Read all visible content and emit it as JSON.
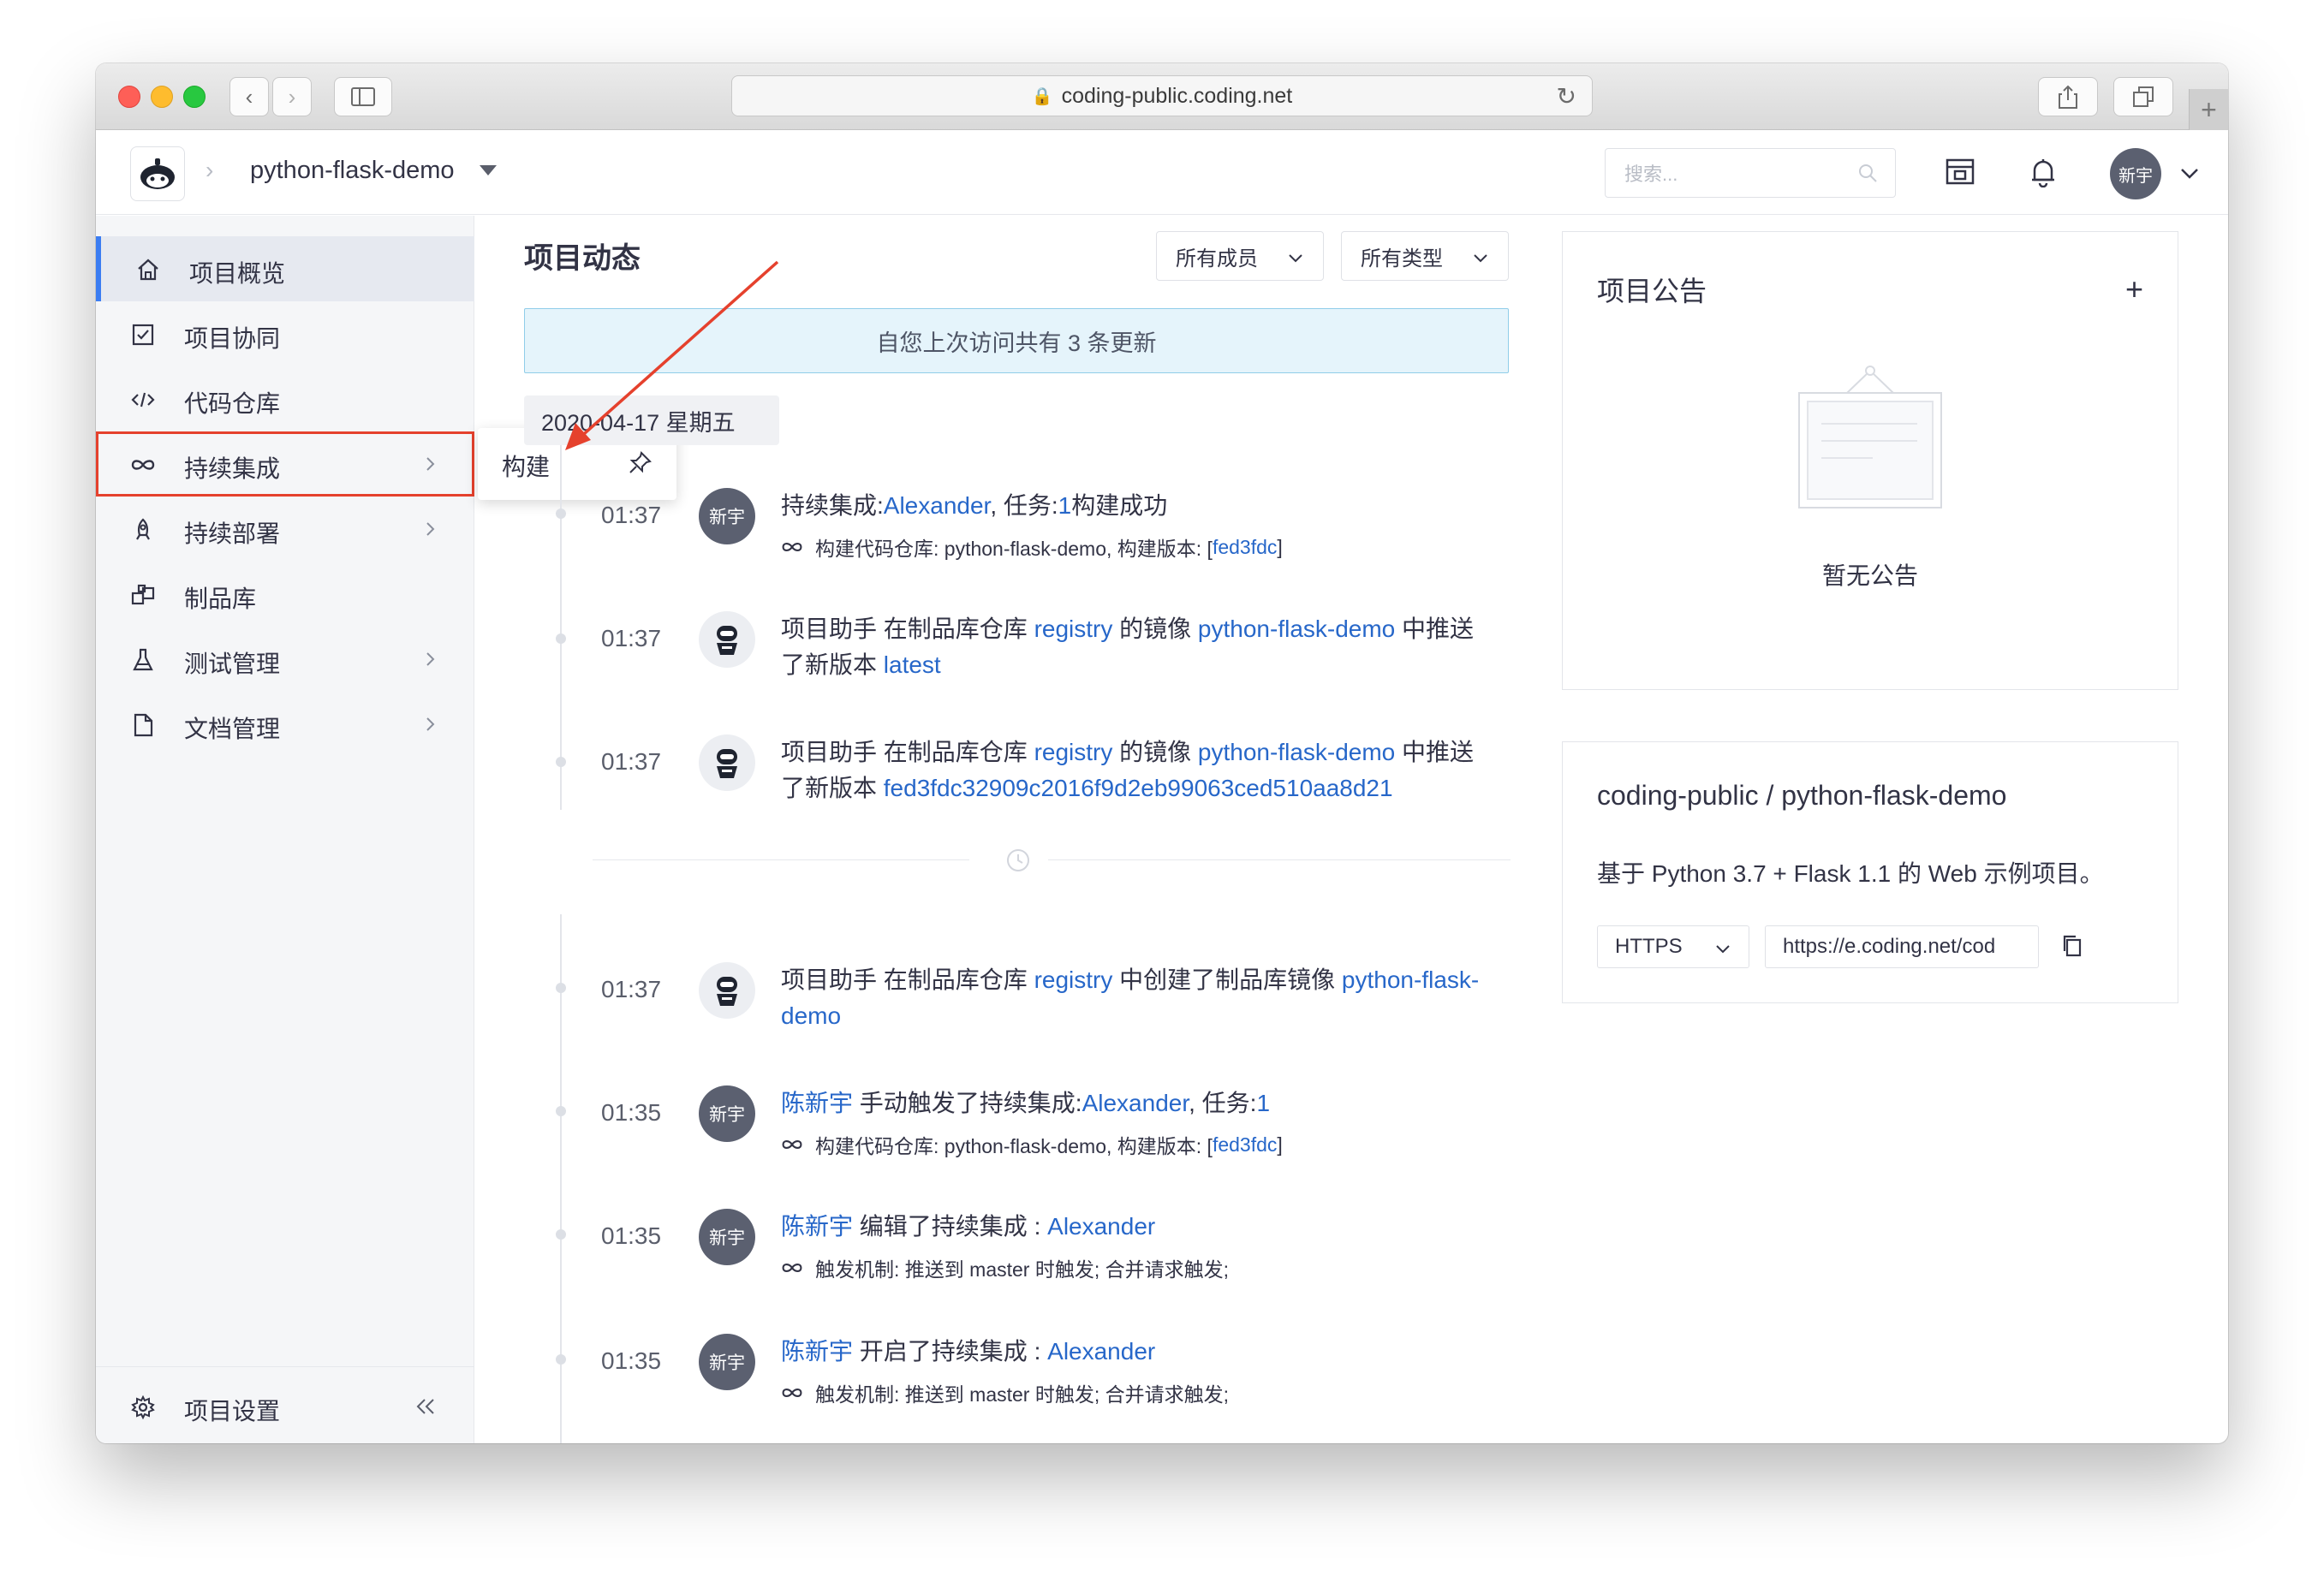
{
  "browser": {
    "url": "coding-public.coding.net"
  },
  "topbar": {
    "project_name": "python-flask-demo",
    "search_placeholder": "搜索...",
    "user_avatar": "新宇"
  },
  "sidebar": {
    "items": [
      {
        "label": "项目概览",
        "icon": "home-icon"
      },
      {
        "label": "项目协同",
        "icon": "checkbox-icon"
      },
      {
        "label": "代码仓库",
        "icon": "code-icon"
      },
      {
        "label": "持续集成",
        "icon": "infinity-icon"
      },
      {
        "label": "持续部署",
        "icon": "rocket-icon"
      },
      {
        "label": "制品库",
        "icon": "artifact-icon"
      },
      {
        "label": "测试管理",
        "icon": "flask-icon"
      },
      {
        "label": "文档管理",
        "icon": "document-icon"
      }
    ],
    "settings_label": "项目设置"
  },
  "flyout": {
    "label": "构建"
  },
  "feed": {
    "title": "项目动态",
    "filter_members": "所有成员",
    "filter_types": "所有类型",
    "notice": "自您上次访问共有 3 条更新",
    "date": "2020-04-17 星期五",
    "events": [
      {
        "time": "01:37",
        "avatar": "新宇",
        "p1": "持续集成:",
        "l1": "Alexander",
        "p2": ", 任务:",
        "l2": "1",
        "p3": "构建成功",
        "sub_prefix": "构建代码仓库: python-flask-demo, 构建版本: [",
        "sub_link": "fed3fdc",
        "sub_suffix": "]"
      },
      {
        "time": "01:37",
        "p1": "项目助手 在制品库仓库 ",
        "l1": "registry",
        "p2": " 的镜像 ",
        "l2": "python-flask-demo",
        "p3": " 中推送了新版本 ",
        "l3": "latest"
      },
      {
        "time": "01:37",
        "p1": "项目助手 在制品库仓库 ",
        "l1": "registry",
        "p2": " 的镜像 ",
        "l2": "python-flask-demo",
        "p3": " 中推送了新版本 ",
        "l3": "fed3fdc32909c2016f9d2eb99063ced510aa8d21"
      },
      {
        "time": "01:37",
        "p1": "项目助手 在制品库仓库 ",
        "l1": "registry",
        "p2": " 中创建了制品库镜像 ",
        "l2": "python-flask-demo"
      },
      {
        "time": "01:35",
        "avatar": "新宇",
        "l0": "陈新宇",
        "p1": " 手动触发了持续集成:",
        "l1": "Alexander",
        "p2": ", 任务:",
        "l2": "1",
        "sub_prefix": "构建代码仓库: python-flask-demo, 构建版本: [",
        "sub_link": "fed3fdc",
        "sub_suffix": "]"
      },
      {
        "time": "01:35",
        "avatar": "新宇",
        "l0": "陈新宇",
        "p1": " 编辑了持续集成 : ",
        "l1": "Alexander",
        "sub_prefix": "触发机制: 推送到 master 时触发; 合并请求触发;"
      },
      {
        "time": "01:35",
        "avatar": "新宇",
        "l0": "陈新宇",
        "p1": " 开启了持续集成 : ",
        "l1": "Alexander",
        "sub_prefix": "触发机制: 推送到 master 时触发; 合并请求触发;"
      }
    ]
  },
  "announcement": {
    "title": "项目公告",
    "empty_text": "暂无公告"
  },
  "repo": {
    "title": "coding-public / python-flask-demo",
    "description": "基于 Python 3.7 + Flask 1.1 的 Web 示例项目。",
    "protocol": "HTTPS",
    "clone_url": "https://e.coding.net/cod"
  },
  "colors": {
    "link": "#2767c9",
    "active_accent": "#3b7df2",
    "annotation_red": "#e5412d",
    "notice_bg": "#e5f4fb"
  }
}
